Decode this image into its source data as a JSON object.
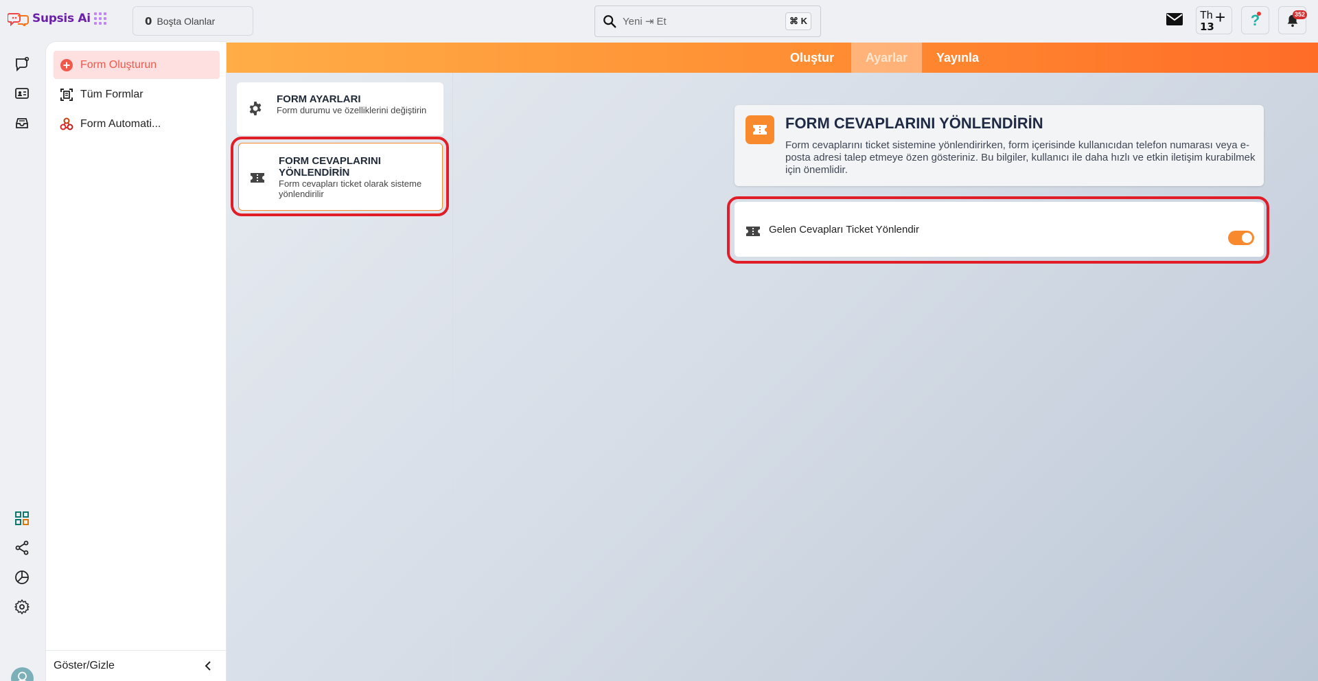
{
  "app": {
    "name": "Supsis Ai"
  },
  "topbar": {
    "idle_count": "0",
    "idle_label": "Boşta Olanlar",
    "search_value": "Yeni ⇥ Et",
    "search_shortcut": "⌘ K",
    "th_label": "Th",
    "th_number": "13",
    "help_label": "?",
    "notification_count": "352"
  },
  "menu": {
    "items": [
      {
        "label": "Form Oluşturun",
        "icon": "add-circle-icon",
        "active": true
      },
      {
        "label": "Tüm Formlar",
        "icon": "document-scan-icon",
        "active": false
      },
      {
        "label": "Form Automati...",
        "icon": "automation-icon",
        "active": false
      }
    ],
    "footer_label": "Göster/Gizle"
  },
  "tabs": [
    {
      "label": "Oluştur",
      "active": false
    },
    {
      "label": "Ayarlar",
      "active": true
    },
    {
      "label": "Yayınla",
      "active": false
    }
  ],
  "settings_cards": [
    {
      "title": "FORM AYARLARI",
      "subtitle": "Form durumu ve özelliklerini değiştirin",
      "icon": "gear-icon"
    },
    {
      "title": "FORM CEVAPLARINI YÖNLENDİRİN",
      "subtitle": "Form cevapları ticket olarak sisteme yönlendirilir",
      "icon": "ticket-icon"
    }
  ],
  "info": {
    "title": "FORM CEVAPLARINI YÖNLENDİRİN",
    "description": "Form cevaplarını ticket sistemine yönlendirirken, form içerisinde kullanıcıdan telefon numarası veya e-posta adresi talep etmeye özen gösteriniz. Bu bilgiler, kullanıcı ile daha hızlı ve etkin iletişim kurabilmek için önemlidir."
  },
  "toggle": {
    "label": "Gelen Cevapları Ticket Yönlendir",
    "enabled": true
  },
  "colors": {
    "accent": "#f88a2d",
    "highlight": "#e11d27",
    "brand": "#6b21a8",
    "active_menu_bg": "#ffe0e0",
    "active_menu_text": "#f0584a"
  }
}
